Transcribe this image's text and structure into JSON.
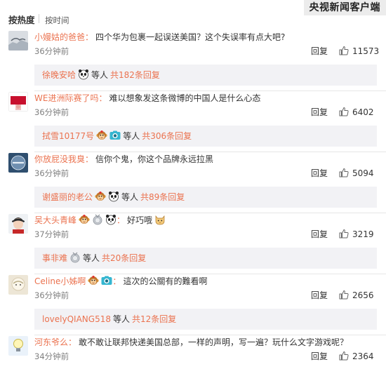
{
  "sort": {
    "hot": "按热度",
    "time": "按时间"
  },
  "watermark": "央视新闻客户端",
  "comments": [
    {
      "user": "小嫚姑的爸爸",
      "text": "四个华为包裹一起误送美国？这个失误率有点大吧?",
      "time": "36分钟前",
      "reply": "回复",
      "likes": "11573",
      "sub": {
        "user": "徐晚安哈",
        "emoji": [
          "panda"
        ],
        "mid": "等人",
        "total": "共182条回复"
      }
    },
    {
      "user": "WE进洲际赛了吗",
      "text": "难以想象发这条微博的中国人是什么心态",
      "time": "36分钟前",
      "reply": "回复",
      "likes": "6402",
      "sub": {
        "user": "拭雪10177号",
        "emoji": [
          "monkey",
          "camera"
        ],
        "mid": "等人",
        "total": "共306条回复"
      }
    },
    {
      "user": "你放屁没我臭",
      "text": "信你个鬼，你这个品牌永远拉黑",
      "time": "36分钟前",
      "reply": "回复",
      "likes": "5094",
      "sub": {
        "user": "谢盛丽的老公",
        "emoji": [
          "monkey",
          "panda"
        ],
        "mid": "等人",
        "total": "共89条回复"
      }
    },
    {
      "user": "吴大头青峰",
      "emoji": [
        "monkey",
        "medal",
        "panda"
      ],
      "text": "好巧哦",
      "trailing_emoji": "cat",
      "time": "37分钟前",
      "reply": "回复",
      "likes": "3219",
      "sub": {
        "user": "事非难",
        "emoji": [
          "medal"
        ],
        "mid": "等人",
        "total": "共20条回复"
      }
    },
    {
      "user": "Celine小姊啊",
      "emoji": [
        "monkey",
        "camera"
      ],
      "text": "這次的公關有的難看啊",
      "time": "36分钟前",
      "reply": "回复",
      "likes": "2656",
      "sub": {
        "user": "lovelyQIANG518",
        "emoji": [],
        "mid": "等人",
        "total": "共12条回复"
      }
    },
    {
      "user": "河东爷么",
      "text": "敢不敢让联邦快递美国总部，一样的声明，写一遍？玩什么文字游戏呢？",
      "time": "34分钟前",
      "reply": "回复",
      "likes": "2364"
    }
  ],
  "icons": {
    "like": "thumbs-up-icon"
  },
  "colors": {
    "username": "#eb7350",
    "subbox": "#f2f2f5"
  }
}
